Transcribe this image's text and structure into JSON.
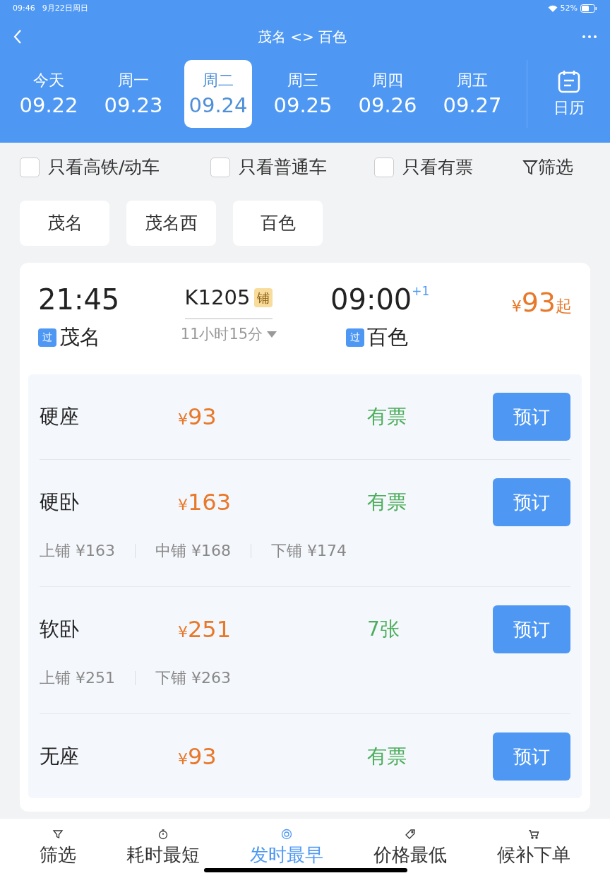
{
  "status_bar": {
    "time": "09:46",
    "date": "9月22日周日",
    "battery": "52%"
  },
  "header": {
    "title": "茂名 <> 百色"
  },
  "dates": [
    {
      "weekday": "今天",
      "date": "09.22",
      "selected": false
    },
    {
      "weekday": "周一",
      "date": "09.23",
      "selected": false
    },
    {
      "weekday": "周二",
      "date": "09.24",
      "selected": true
    },
    {
      "weekday": "周三",
      "date": "09.25",
      "selected": false
    },
    {
      "weekday": "周四",
      "date": "09.26",
      "selected": false
    },
    {
      "weekday": "周五",
      "date": "09.27",
      "selected": false
    }
  ],
  "calendar_button": "日历",
  "filters": [
    {
      "label": "只看高铁/动车",
      "checked": false
    },
    {
      "label": "只看普通车",
      "checked": false
    },
    {
      "label": "只看有票",
      "checked": false
    }
  ],
  "filter_button": "筛选",
  "stations": [
    "茂名",
    "茂名西",
    "百色"
  ],
  "train": {
    "depart_time": "21:45",
    "depart_badge": "过",
    "depart_station": "茂名",
    "number": "K1205",
    "berth_tag": "铺",
    "duration": "11小时15分",
    "arrive_time": "09:00",
    "day_offset": "+1",
    "arrive_badge": "过",
    "arrive_station": "百色",
    "currency": "¥",
    "price": "93",
    "price_suffix": "起"
  },
  "seats": [
    {
      "name": "硬座",
      "currency": "¥",
      "price": "93",
      "availability": "有票",
      "button": "预订"
    },
    {
      "name": "硬卧",
      "currency": "¥",
      "price": "163",
      "availability": "有票",
      "button": "预订",
      "berths": [
        "上铺 ¥163",
        "中铺 ¥168",
        "下铺 ¥174"
      ]
    },
    {
      "name": "软卧",
      "currency": "¥",
      "price": "251",
      "availability": "7张",
      "button": "预订",
      "berths": [
        "上铺 ¥251",
        "下铺 ¥263"
      ]
    },
    {
      "name": "无座",
      "currency": "¥",
      "price": "93",
      "availability": "有票",
      "button": "预订"
    }
  ],
  "sort_bar": [
    {
      "kind": "filter",
      "label": "筛选",
      "selected": false
    },
    {
      "kind": "timer",
      "label": "耗时最短",
      "selected": false
    },
    {
      "kind": "clock",
      "label": "发时最早",
      "selected": true
    },
    {
      "kind": "tag",
      "label": "价格最低",
      "selected": false
    },
    {
      "kind": "cart",
      "label": "候补下单",
      "selected": false
    }
  ]
}
